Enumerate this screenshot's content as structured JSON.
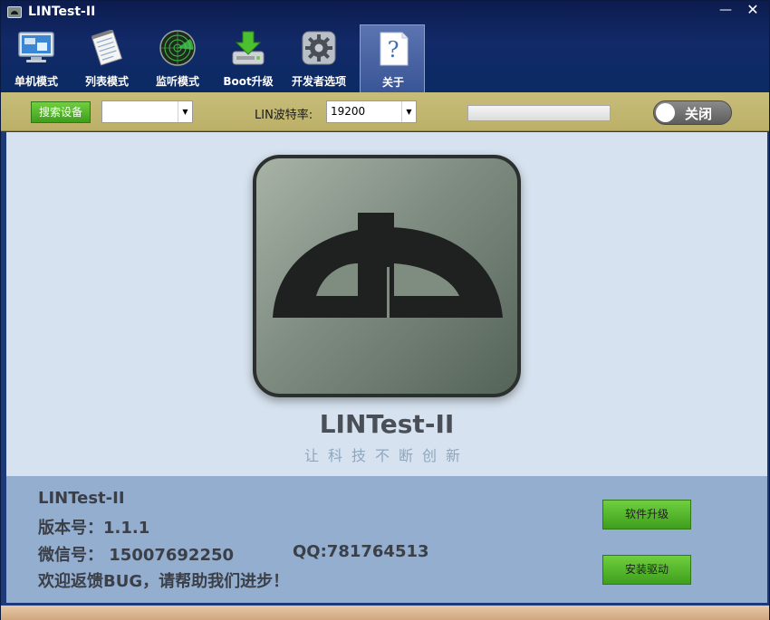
{
  "window": {
    "title": "LINTest-II"
  },
  "toolbar": {
    "items": [
      {
        "label": "单机模式",
        "icon": "monitor-icon"
      },
      {
        "label": "列表模式",
        "icon": "notepad-icon"
      },
      {
        "label": "监听模式",
        "icon": "radar-icon"
      },
      {
        "label": "Boot升级",
        "icon": "download-drive-icon"
      },
      {
        "label": "开发者选项",
        "icon": "gear-icon"
      },
      {
        "label": "关于",
        "icon": "help-icon"
      }
    ],
    "active_index": 5
  },
  "actionbar": {
    "search_label": "搜索设备",
    "device_value": "",
    "baud_label": "LIN波特率:",
    "baud_value": "19200",
    "toggle_label": "关闭"
  },
  "about": {
    "app_name": "LINTest-II",
    "slogan": "让科技不断创新"
  },
  "info": {
    "line1": "LINTest-II",
    "line2": "版本号：1.1.1",
    "line3": "微信号： 15007692250",
    "qq": "QQ:781764513",
    "line4": "欢迎返馈BUG，请帮助我们进步！",
    "upgrade_label": "软件升级",
    "driver_label": "安装驱动"
  },
  "colors": {
    "header": "#122a68",
    "actionbar": "#c7bd7a",
    "main_bg": "#d6e2ef",
    "info_bg": "#94aed0",
    "green_button": "#4fb12a"
  }
}
